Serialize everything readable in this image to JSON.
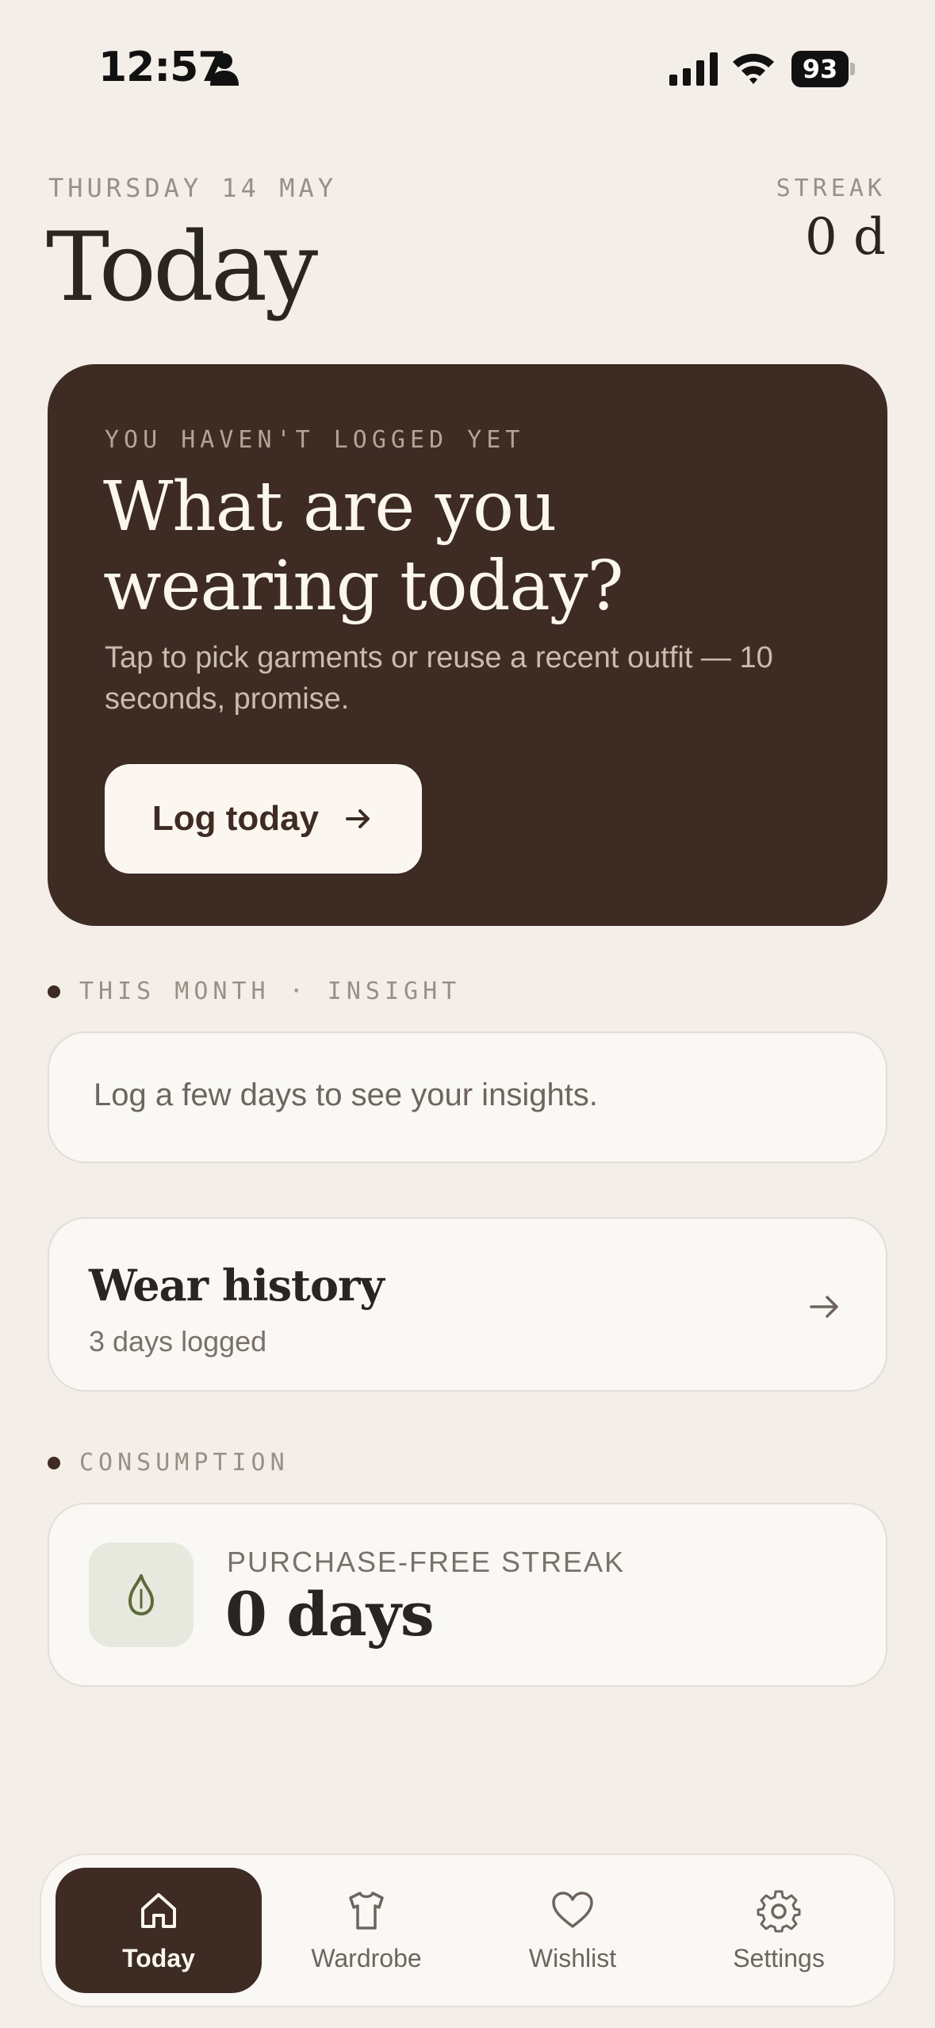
{
  "status_bar": {
    "time": "12:57",
    "battery": "93"
  },
  "header": {
    "date": "THURSDAY 14 MAY",
    "title": "Today",
    "streak_label": "STREAK",
    "streak_value": "0 d"
  },
  "hero": {
    "eyebrow": "YOU HAVEN'T LOGGED YET",
    "title": "What are you wearing today?",
    "body": "Tap to pick garments or reuse a recent outfit — 10 seconds, promise.",
    "button_label": "Log today"
  },
  "insight": {
    "section_label": "THIS MONTH · INSIGHT",
    "text": "Log a few days to see your insights."
  },
  "history": {
    "title": "Wear history",
    "subtitle": "3 days logged"
  },
  "consumption": {
    "section_label": "CONSUMPTION",
    "label": "PURCHASE-FREE STREAK",
    "value": "0 days"
  },
  "tabs": [
    {
      "label": "Today",
      "icon": "home-icon",
      "active": true
    },
    {
      "label": "Wardrobe",
      "icon": "shirt-icon",
      "active": false
    },
    {
      "label": "Wishlist",
      "icon": "heart-icon",
      "active": false
    },
    {
      "label": "Settings",
      "icon": "gear-icon",
      "active": false
    }
  ],
  "colors": {
    "background": "#f4eee8",
    "accent_dark": "#3d2b24",
    "card": "#faf8f4",
    "leaf_tile": "#e8e9de",
    "leaf": "#5d6b3a"
  }
}
